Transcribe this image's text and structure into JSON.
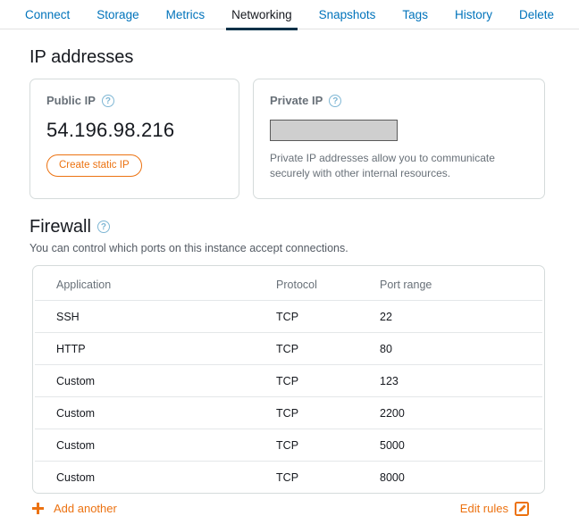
{
  "tabs": [
    {
      "label": "Connect",
      "active": false
    },
    {
      "label": "Storage",
      "active": false
    },
    {
      "label": "Metrics",
      "active": false
    },
    {
      "label": "Networking",
      "active": true
    },
    {
      "label": "Snapshots",
      "active": false
    },
    {
      "label": "Tags",
      "active": false
    },
    {
      "label": "History",
      "active": false
    },
    {
      "label": "Delete",
      "active": false
    }
  ],
  "ip_section": {
    "title": "IP addresses",
    "public": {
      "label": "Public IP",
      "help_icon": "help-circle-icon",
      "help_glyph": "?",
      "value": "54.196.98.216",
      "button_label": "Create static IP"
    },
    "private": {
      "label": "Private IP",
      "help_icon": "help-circle-icon",
      "help_glyph": "?",
      "value": "",
      "masked": true,
      "description": "Private IP addresses allow you to communicate securely with other internal resources."
    }
  },
  "firewall": {
    "title": "Firewall",
    "help_icon": "help-circle-icon",
    "help_glyph": "?",
    "description": "You can control which ports on this instance accept connections.",
    "columns": [
      "Application",
      "Protocol",
      "Port range"
    ],
    "rows": [
      {
        "application": "SSH",
        "protocol": "TCP",
        "port_range": "22"
      },
      {
        "application": "HTTP",
        "protocol": "TCP",
        "port_range": "80"
      },
      {
        "application": "Custom",
        "protocol": "TCP",
        "port_range": "123"
      },
      {
        "application": "Custom",
        "protocol": "TCP",
        "port_range": "2200"
      },
      {
        "application": "Custom",
        "protocol": "TCP",
        "port_range": "5000"
      },
      {
        "application": "Custom",
        "protocol": "TCP",
        "port_range": "8000"
      }
    ],
    "add_another_label": "Add another",
    "add_icon": "plus-icon",
    "edit_rules_label": "Edit rules",
    "edit_icon": "edit-pencil-square-icon"
  },
  "colors": {
    "link_blue": "#0073bb",
    "active_tab": "#003047",
    "accent_orange": "#ec7211",
    "text_dark": "#16191f",
    "text_muted": "#687078",
    "border": "#d5dbdb",
    "help_blue": "#7eb6d4",
    "masked_fill": "#cfcfcf"
  }
}
